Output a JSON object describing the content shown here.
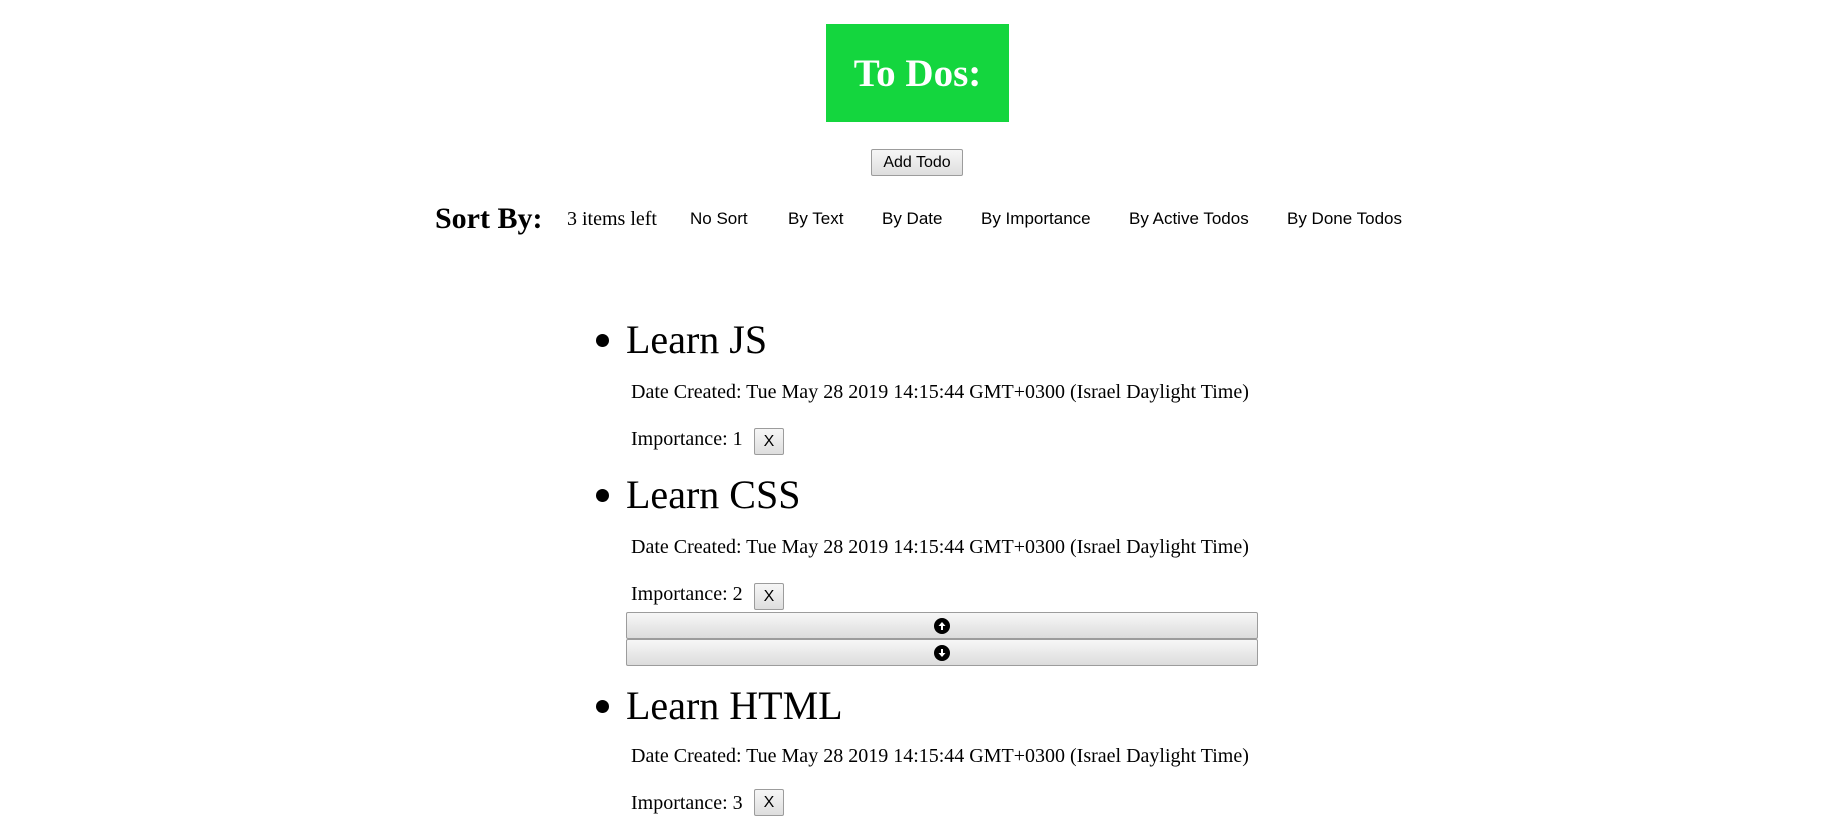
{
  "header": {
    "title": "To Dos:",
    "title_bg": "#14d63e",
    "add_button_label": "Add Todo"
  },
  "sort": {
    "label": "Sort By:",
    "items_left": "3 items left",
    "options": [
      "No Sort",
      "By Text",
      "By Date",
      "By Importance",
      "By Active Todos",
      "By Done Todos"
    ]
  },
  "todos": [
    {
      "text": "Learn JS",
      "date": "Date Created: Tue May 28 2019 14:15:44 GMT+0300 (Israel Daylight Time)",
      "importance": "Importance: 1",
      "delete_label": "X"
    },
    {
      "text": "Learn CSS",
      "date": "Date Created: Tue May 28 2019 14:15:44 GMT+0300 (Israel Daylight Time)",
      "importance": "Importance: 2",
      "delete_label": "X"
    },
    {
      "text": "Learn HTML",
      "date": "Date Created: Tue May 28 2019 14:15:44 GMT+0300 (Israel Daylight Time)",
      "importance": "Importance: 3",
      "delete_label": "X"
    }
  ],
  "move_controls": {
    "up_icon": "arrow-up-circle-icon",
    "down_icon": "arrow-down-circle-icon"
  }
}
